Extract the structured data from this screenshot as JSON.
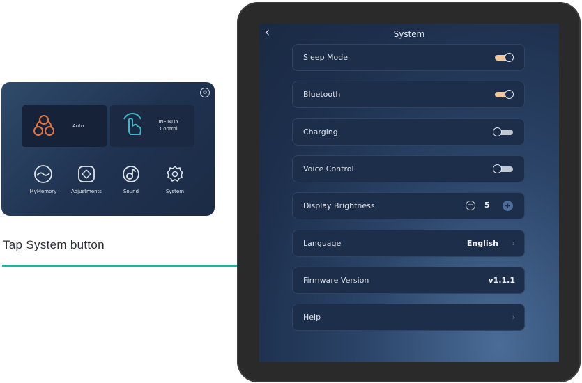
{
  "home_panel": {
    "cards": [
      {
        "label": "Auto",
        "icon": "auto-mode-icon",
        "color": "#e8733f"
      },
      {
        "label": "INFINITY\nControl",
        "icon": "hand-touch-icon",
        "color": "#3fb6c8"
      }
    ],
    "tiles": [
      {
        "label": "MyMemory",
        "icon": "memory-icon"
      },
      {
        "label": "Adjustments",
        "icon": "adjustments-icon"
      },
      {
        "label": "Sound",
        "icon": "sound-icon"
      },
      {
        "label": "System",
        "icon": "gear-icon"
      }
    ]
  },
  "caption": "Tap System button",
  "system_screen": {
    "title": "System",
    "back_icon": "chevron-left-icon",
    "rows": [
      {
        "label": "Sleep Mode",
        "type": "toggle",
        "state": "on"
      },
      {
        "label": "Bluetooth",
        "type": "toggle",
        "state": "on"
      },
      {
        "label": "Charging",
        "type": "toggle",
        "state": "off"
      },
      {
        "label": "Voice Control",
        "type": "toggle",
        "state": "off"
      },
      {
        "label": "Display Brightness",
        "type": "stepper",
        "value": "5"
      },
      {
        "label": "Language",
        "type": "select",
        "value": "English"
      },
      {
        "label": "Firmware Version",
        "type": "info",
        "value": "v1.1.1"
      },
      {
        "label": "Help",
        "type": "link"
      }
    ]
  },
  "colors": {
    "accent_teal": "#2fa99a",
    "toggle_on": "#f1c79e",
    "toggle_off": "#c0c7d2",
    "auto_orange": "#e8733f",
    "infinity_cyan": "#3fb6c8"
  }
}
